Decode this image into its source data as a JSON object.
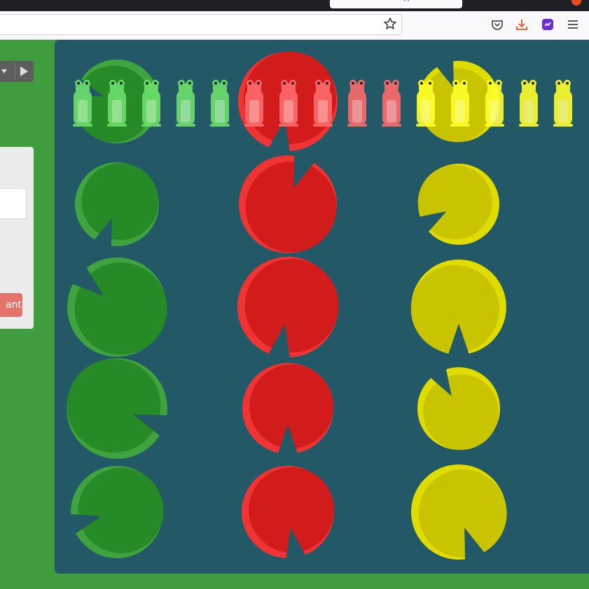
{
  "browser": {
    "tab_icon_names": [
      "close-icon"
    ],
    "toolbar_icons": [
      "bookmark-star-icon",
      "pocket-icon",
      "download-icon",
      "extension-icon",
      "menu-icon"
    ]
  },
  "side_panel": {
    "action_button_label": "ant",
    "controls": [
      "dropdown-chevron-icon",
      "play-icon"
    ]
  },
  "colors": {
    "background": "#3f9c3f",
    "pond": "#235867",
    "green_pad": "#268a26",
    "green_pad_rim": "#3fa33f",
    "red_pad": "#d21b1b",
    "red_pad_rim": "#f03434",
    "yellow_pad": "#c8c400",
    "yellow_pad_rim": "#e0dc00",
    "green_frog": "#6de06d",
    "red_frog": "#ff6b6b",
    "yellow_frog": "#ffff2a"
  },
  "board": {
    "columns": [
      "green",
      "red",
      "yellow"
    ],
    "rows": 5,
    "frogs": [
      {
        "color": "green",
        "count": 5
      },
      {
        "color": "red",
        "count": 5
      },
      {
        "color": "yellow",
        "count": 5
      }
    ]
  }
}
